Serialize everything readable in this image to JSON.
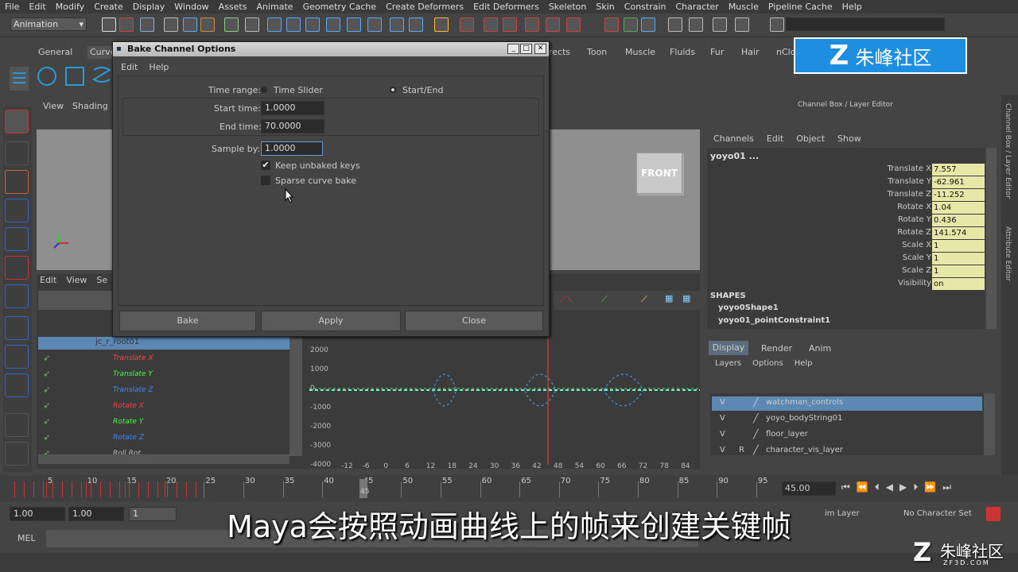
{
  "menubar": [
    "File",
    "Edit",
    "Modify",
    "Create",
    "Display",
    "Window",
    "Assets",
    "Animate",
    "Geometry Cache",
    "Create Deformers",
    "Edit Deformers",
    "Skeleton",
    "Skin",
    "Constrain",
    "Character",
    "Muscle",
    "Pipeline Cache",
    "Help"
  ],
  "mode": "Animation",
  "shelf_tabs": [
    "General",
    "Curves",
    "rects",
    "Toon",
    "Muscle",
    "Fluids",
    "Fur",
    "Hair",
    "nClo"
  ],
  "watermark": "朱峰社区",
  "watermark_small": "朱峰社区",
  "watermark_url": "ZF3D.COM",
  "viewport": {
    "menus": [
      "View",
      "Shading"
    ],
    "front_label": "FRONT"
  },
  "graph": {
    "menus": [
      "Edit",
      "View",
      "Se"
    ],
    "root_node": "jc_r_root01",
    "channels": [
      {
        "name": "Translate X",
        "color": "#ff4444"
      },
      {
        "name": "Translate Y",
        "color": "#44ff44"
      },
      {
        "name": "Translate Z",
        "color": "#4488ff"
      },
      {
        "name": "Rotate X",
        "color": "#ff4444"
      },
      {
        "name": "Rotate Y",
        "color": "#44ff44"
      },
      {
        "name": "Rotate Z",
        "color": "#4488ff"
      },
      {
        "name": "Roll Rot...",
        "color": "#bbbbbb"
      }
    ],
    "y_ticks": [
      "2000",
      "1000",
      "0",
      "-1000",
      "-2000",
      "-3000",
      "-4000"
    ],
    "x_ticks": [
      "-12",
      "-6",
      "0",
      "6",
      "12",
      "18",
      "24",
      "30",
      "36",
      "42",
      "48",
      "54",
      "60",
      "66",
      "72",
      "78",
      "84"
    ]
  },
  "dialog": {
    "title": "Bake Channel Options",
    "menus": [
      "Edit",
      "Help"
    ],
    "time_range_label": "Time range:",
    "opt_time_slider": "Time Slider",
    "opt_start_end": "Start/End",
    "start_label": "Start time:",
    "start_value": "1.0000",
    "end_label": "End time:",
    "end_value": "70.0000",
    "sample_label": "Sample by:",
    "sample_value": "1.0000",
    "keep_unbaked": "Keep unbaked keys",
    "sparse": "Sparse curve bake",
    "bake": "Bake",
    "apply": "Apply",
    "close": "Close"
  },
  "channelbox": {
    "title": "Channel Box / Layer Editor",
    "menus": [
      "Channels",
      "Edit",
      "Object",
      "Show"
    ],
    "object": "yoyo01 ...",
    "attrs": [
      {
        "name": "Translate X",
        "value": "7.557"
      },
      {
        "name": "Translate Y",
        "value": "-62.961"
      },
      {
        "name": "Translate Z",
        "value": "-11.252"
      },
      {
        "name": "Rotate X",
        "value": "1.04"
      },
      {
        "name": "Rotate Y",
        "value": "0.436"
      },
      {
        "name": "Rotate Z",
        "value": "141.574"
      },
      {
        "name": "Scale X",
        "value": "1"
      },
      {
        "name": "Scale Y",
        "value": "1"
      },
      {
        "name": "Scale Z",
        "value": "1"
      },
      {
        "name": "Visibility",
        "value": "on"
      }
    ],
    "shapes_label": "SHAPES",
    "shapes": [
      "yoyo0Shape1",
      "yoyo01_pointConstraint1"
    ],
    "side_tabs": [
      "Channel Box / Layer Editor",
      "Attribute Editor"
    ]
  },
  "layers": {
    "tabs": [
      "Display",
      "Render",
      "Anim"
    ],
    "menus": [
      "Layers",
      "Options",
      "Help"
    ],
    "rows": [
      {
        "v": "V",
        "r": "",
        "name": "watchman_controls"
      },
      {
        "v": "V",
        "r": "",
        "name": "yoyo_bodyString01"
      },
      {
        "v": "V",
        "r": "",
        "name": "floor_layer"
      },
      {
        "v": "V",
        "r": "R",
        "name": "character_vis_layer"
      }
    ]
  },
  "timeslider": {
    "ticks": [
      "5",
      "10",
      "15",
      "20",
      "25",
      "30",
      "35",
      "40",
      "45",
      "50",
      "55",
      "60",
      "65",
      "70",
      "75",
      "80",
      "85",
      "90",
      "95"
    ],
    "current": "45.00",
    "current_marker": "45"
  },
  "range": {
    "start": "1.00",
    "start2": "1.00",
    "field3": "1",
    "anim_layer": "im Layer",
    "char_set": "No Character Set"
  },
  "cmd": {
    "label": "MEL"
  },
  "subtitle": "Maya会按照动画曲线上的帧来创建关键帧"
}
